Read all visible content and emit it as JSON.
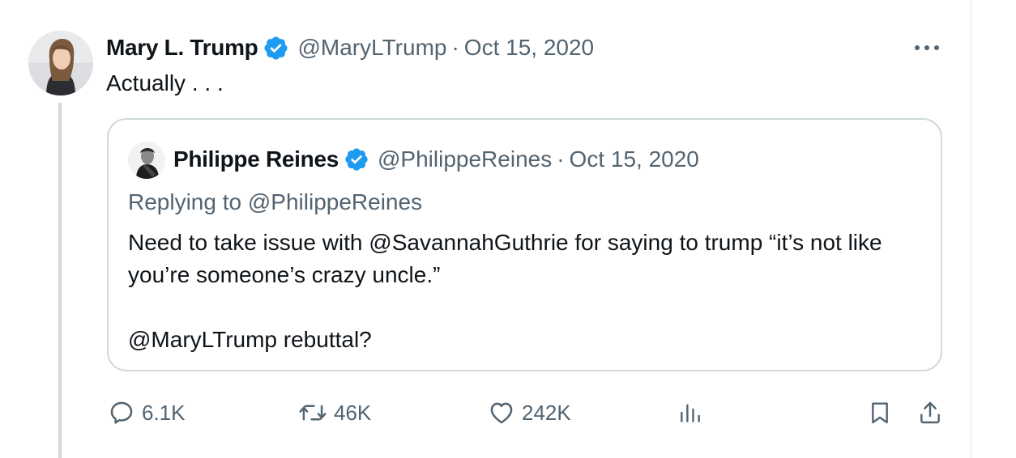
{
  "tweet": {
    "author_name": "Mary L. Trump",
    "author_handle": "@MaryLTrump",
    "separator": "·",
    "date": "Oct 15, 2020",
    "text": "Actually . . ."
  },
  "quoted_tweet": {
    "author_name": "Philippe Reines",
    "author_handle": "@PhilippeReines",
    "separator": "·",
    "date": "Oct 15, 2020",
    "replying_to": "Replying to @PhilippeReines",
    "body_line_1": "Need to take issue with @SavannahGuthrie for saying to trump “it’s not like you’re someone’s crazy uncle.”",
    "body_line_2": "@MaryLTrump rebuttal?"
  },
  "actions": {
    "replies": "6.1K",
    "reposts": "46K",
    "likes": "242K"
  },
  "icons": {
    "verified": "verified-badge-icon",
    "more": "more-icon",
    "reply": "reply-icon",
    "repost": "repost-icon",
    "like": "heart-icon",
    "views": "views-icon",
    "bookmark": "bookmark-icon",
    "share": "share-icon"
  },
  "colors": {
    "verified": "#1d9bf0",
    "secondary_text": "#536471",
    "primary_text": "#0f1419",
    "border": "#cfd9de"
  }
}
